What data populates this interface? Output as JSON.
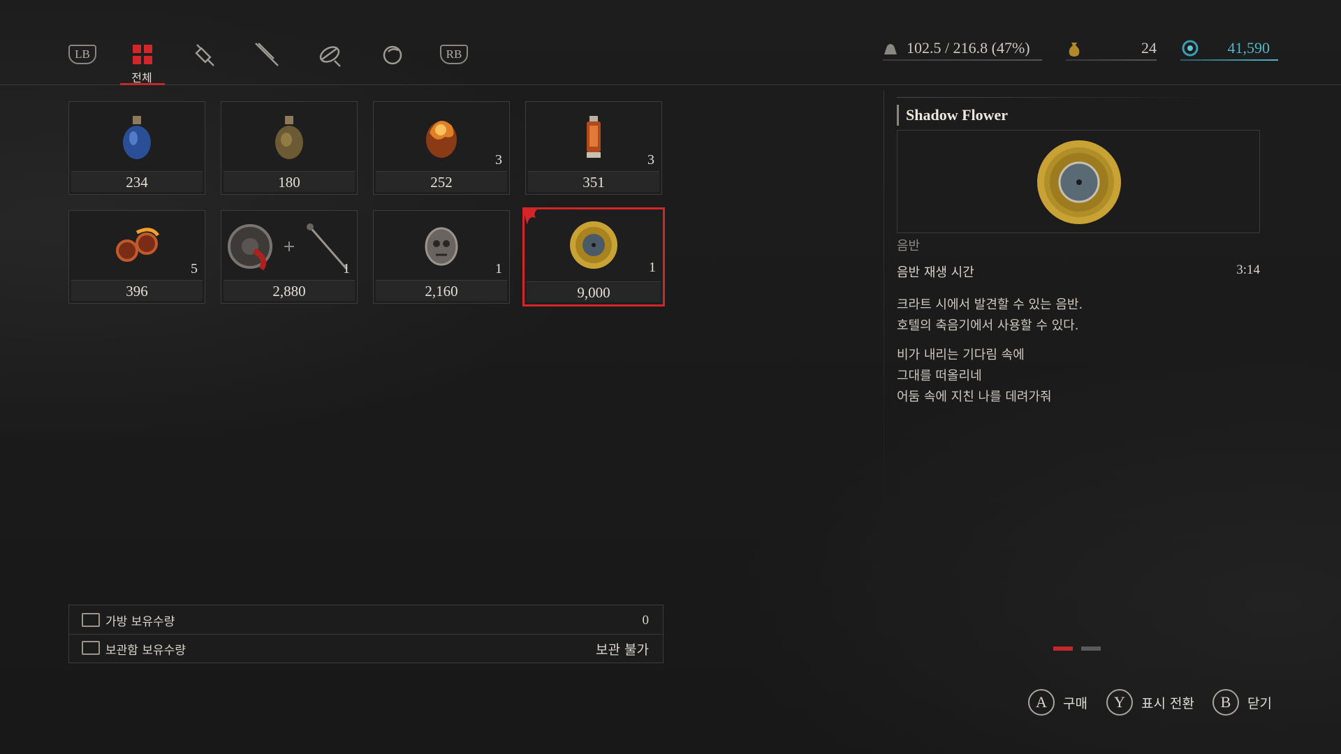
{
  "topbar": {
    "tabs": [
      {
        "id": "lb",
        "label": "LB"
      },
      {
        "id": "all",
        "label": "전체",
        "active": true
      },
      {
        "id": "recovery",
        "icon": "syringe-icon"
      },
      {
        "id": "weapons",
        "icon": "knife-icon"
      },
      {
        "id": "materials",
        "icon": "materials-icon"
      },
      {
        "id": "valuables",
        "icon": "orb-icon"
      },
      {
        "id": "rb",
        "label": "RB"
      }
    ],
    "weight": "102.5 / 216.8 (47%)",
    "currency_a": "24",
    "currency_b": "41,590"
  },
  "items": [
    {
      "name": "blue-potion",
      "price": "234",
      "qty": ""
    },
    {
      "name": "amber-potion",
      "price": "180",
      "qty": ""
    },
    {
      "name": "fire-grenade",
      "price": "252",
      "qty": "3"
    },
    {
      "name": "lantern",
      "price": "351",
      "qty": "3"
    },
    {
      "name": "flame-cogs",
      "price": "396",
      "qty": "5"
    },
    {
      "name": "wheel-and-tool",
      "price": "2,880",
      "qty": "1"
    },
    {
      "name": "skull-ornament",
      "price": "2,160",
      "qty": "1"
    },
    {
      "name": "gold-record",
      "price": "9,000",
      "qty": "1",
      "selected": true
    }
  ],
  "holdings": {
    "bag_label": "가방 보유수량",
    "bag_value": "0",
    "storage_label": "보관함 보유수량",
    "storage_value": "보관 불가"
  },
  "detail": {
    "title": "Shadow Flower",
    "category": "음반",
    "spec_label": "음반 재생 시간",
    "spec_value": "3:14",
    "desc_1": "크라트 시에서 발견할 수 있는 음반.",
    "desc_2": "호텔의 축음기에서 사용할 수 있다.",
    "lyric_1": "비가 내리는 기다림 속에",
    "lyric_2": "그대를 떠올리네",
    "lyric_3": "어둠 속에 지친 나를 데려가줘"
  },
  "prompts": {
    "a_key": "A",
    "a_label": "구매",
    "y_key": "Y",
    "y_label": "표시 전환",
    "b_key": "B",
    "b_label": "닫기"
  },
  "colors": {
    "accent_red": "#d3262a",
    "currency_b": "#4fb6c8",
    "gold": "#c9a235"
  }
}
